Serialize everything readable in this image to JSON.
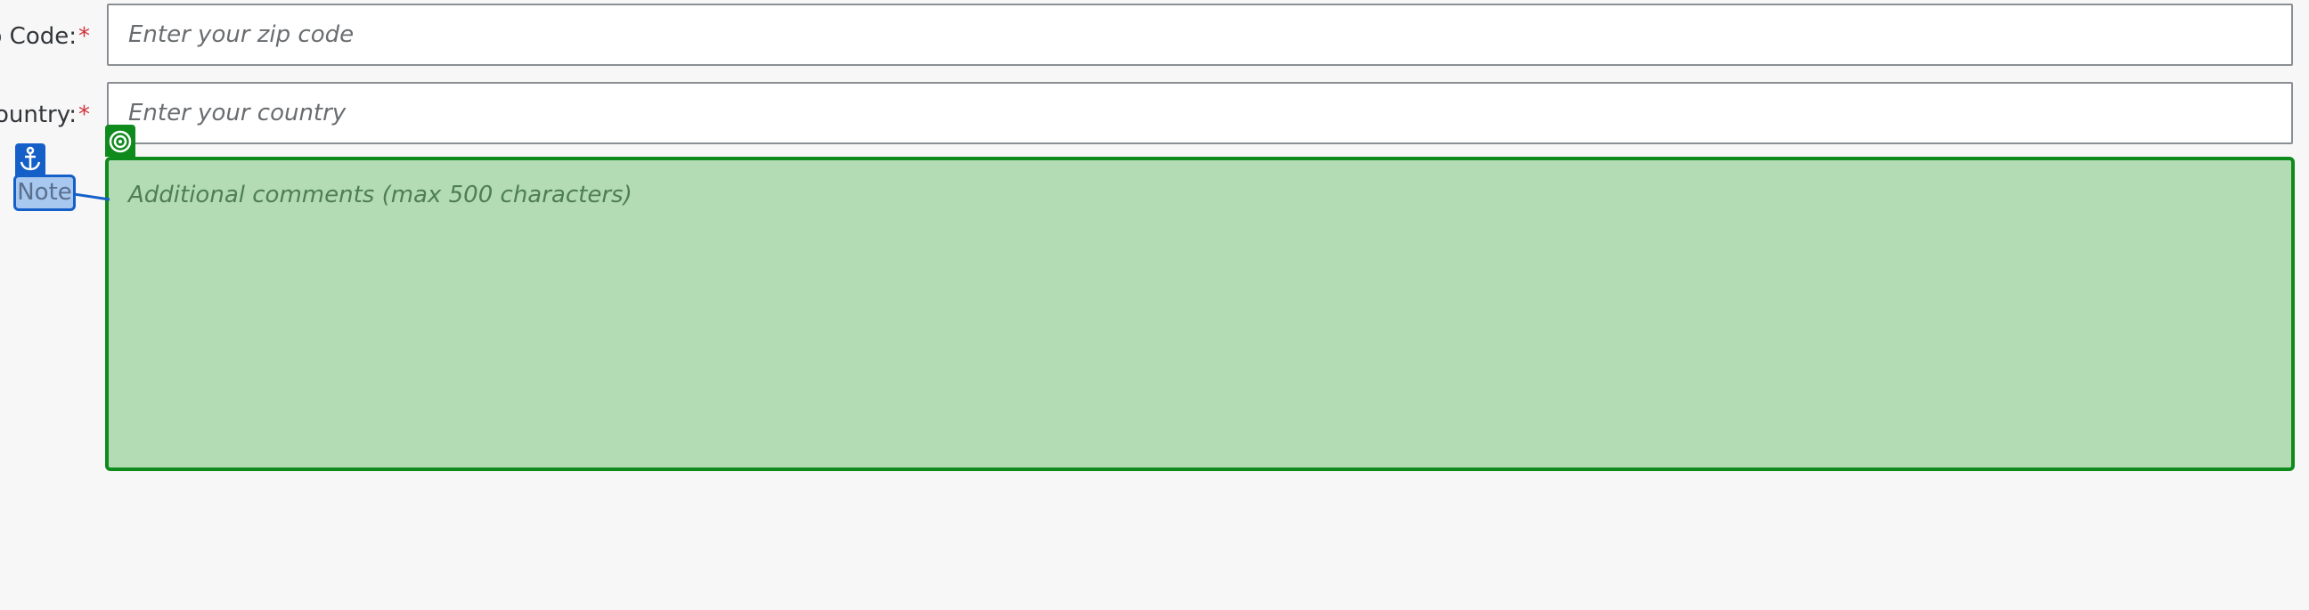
{
  "form": {
    "zip": {
      "label": "p Code:",
      "required_mark": "*",
      "placeholder": "Enter your zip code"
    },
    "country": {
      "label": "ountry:",
      "required_mark": "*",
      "placeholder": "Enter your country"
    },
    "comments": {
      "placeholder": "Additional comments (max 500 characters)"
    }
  },
  "annotations": {
    "note_label": "Note",
    "anchor_icon": "anchor-icon",
    "target_icon": "target-icon"
  },
  "colors": {
    "required": "#d0343c",
    "highlight_fill": "#b3dcb5",
    "highlight_border": "#0f8a1d",
    "annotation_blue": "#1560c8",
    "note_fill": "#a8c8ef"
  }
}
